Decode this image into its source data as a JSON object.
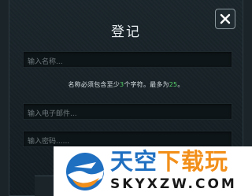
{
  "dialog": {
    "title": "登记",
    "close_icon": "close-icon"
  },
  "form": {
    "name_placeholder": "输入名称...",
    "hint": {
      "part1": "名称必须包含至少",
      "min": "3",
      "part2": "个字符。最多为",
      "max": "25",
      "part3": "。"
    },
    "email_placeholder": "输入电子邮件...",
    "password_placeholder": "输入密码......"
  },
  "watermark": {
    "title_main": "天空",
    "title_sub": "下载玩",
    "domain": "SKYXZW.COM"
  },
  "colors": {
    "accent_green": "#57d36a",
    "watermark_blue": "#1f6fc1",
    "watermark_orange": "#f28f1a"
  }
}
